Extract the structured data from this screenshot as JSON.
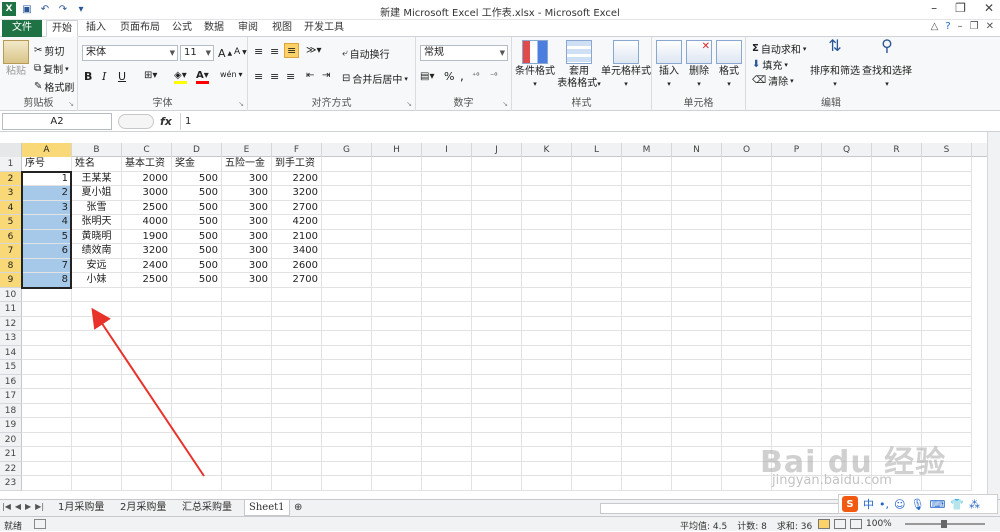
{
  "window": {
    "title": "新建 Microsoft Excel 工作表.xlsx - Microsoft Excel"
  },
  "tabs": [
    "文件",
    "开始",
    "插入",
    "页面布局",
    "公式",
    "数据",
    "审阅",
    "视图",
    "开发工具"
  ],
  "active_tab": "开始",
  "ribbon": {
    "clipboard": {
      "label": "剪贴板",
      "paste": "粘贴",
      "cut": "剪切",
      "copy": "复制",
      "format_painter": "格式刷"
    },
    "font": {
      "label": "字体",
      "name": "宋体",
      "size": "11",
      "bold": "B",
      "italic": "I",
      "underline": "U",
      "phonetic": "wén"
    },
    "alignment": {
      "label": "对齐方式",
      "wrap": "自动换行",
      "merge": "合并后居中"
    },
    "number": {
      "label": "数字",
      "format": "常规",
      "percent": "%",
      "comma": ","
    },
    "styles": {
      "label": "样式",
      "conditional": "条件格式",
      "table_top": "套用",
      "table_bottom": "表格格式",
      "cell_styles": "单元格样式"
    },
    "cells": {
      "label": "单元格",
      "insert": "插入",
      "delete": "删除",
      "format": "格式"
    },
    "editing": {
      "label": "编辑",
      "autosum": "自动求和",
      "fill": "填充",
      "clear": "清除",
      "sort": "排序和筛选",
      "find": "查找和选择"
    }
  },
  "formula_bar": {
    "name_box": "A2",
    "fx": "fx",
    "value": "1"
  },
  "columns": [
    "A",
    "B",
    "C",
    "D",
    "E",
    "F",
    "G",
    "H",
    "I",
    "J",
    "K",
    "L",
    "M",
    "N",
    "O",
    "P",
    "Q",
    "R",
    "S"
  ],
  "rows": [
    "1",
    "2",
    "3",
    "4",
    "5",
    "6",
    "7",
    "8",
    "9",
    "10",
    "11",
    "12",
    "13",
    "14",
    "15",
    "16",
    "17",
    "18",
    "19",
    "20",
    "21",
    "22",
    "23"
  ],
  "table": {
    "headers": [
      "序号",
      "姓名",
      "基本工资",
      "奖金",
      "五险一金",
      "到手工资"
    ],
    "data": [
      [
        "1",
        "王某某",
        "2000",
        "500",
        "300",
        "2200"
      ],
      [
        "2",
        "夏小姐",
        "3000",
        "500",
        "300",
        "3200"
      ],
      [
        "3",
        "张雪",
        "2500",
        "500",
        "300",
        "2700"
      ],
      [
        "4",
        "张明天",
        "4000",
        "500",
        "300",
        "4200"
      ],
      [
        "5",
        "黄晓明",
        "1900",
        "500",
        "300",
        "2100"
      ],
      [
        "6",
        "绩效南",
        "3200",
        "500",
        "300",
        "3400"
      ],
      [
        "7",
        "安远",
        "2400",
        "500",
        "300",
        "2600"
      ],
      [
        "8",
        "小妹",
        "2500",
        "500",
        "300",
        "2700"
      ]
    ]
  },
  "sheet_tabs": [
    "1月采购量",
    "2月采购量",
    "汇总采购量",
    "Sheet1"
  ],
  "active_sheet": "Sheet1",
  "status": {
    "ready": "就绪",
    "average": "平均值: 4.5",
    "count": "计数: 8",
    "sum": "求和: 36",
    "zoom": "100%"
  },
  "watermark": {
    "main": "Bai du 经验",
    "sub": "jingyan.baidu.com"
  },
  "ime": {
    "logo": "S",
    "lang": "中"
  },
  "colors": {
    "excel_green": "#1f7244",
    "selection": "#a6c9ea",
    "header_highlight": "#f9d977",
    "arrow": "#e8332b"
  }
}
